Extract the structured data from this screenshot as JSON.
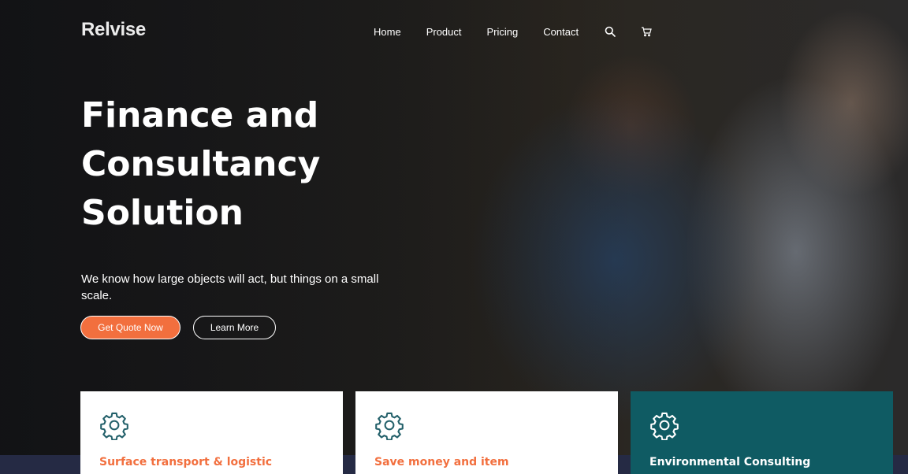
{
  "brand": {
    "logo": "Relvise"
  },
  "nav": {
    "items": [
      {
        "label": "Home"
      },
      {
        "label": "Product"
      },
      {
        "label": "Pricing"
      },
      {
        "label": "Contact"
      }
    ],
    "icons": [
      "search-icon",
      "cart-icon"
    ]
  },
  "hero": {
    "headline": "Finance and Consultancy Solution",
    "subtitle": "We know how large objects will act, but things on a small scale.",
    "primary_button": "Get Quote Now",
    "secondary_button": "Learn More"
  },
  "cards": [
    {
      "title": "Surface transport & logistic",
      "icon": "gear-icon",
      "theme": "light"
    },
    {
      "title": "Save money and item",
      "icon": "gear-icon",
      "theme": "light"
    },
    {
      "title": "Environmental Consulting",
      "icon": "gear-icon",
      "theme": "dark"
    }
  ],
  "colors": {
    "accent": "#f26f3e",
    "teal": "#0f5b63",
    "icon_teal": "#23606a"
  }
}
